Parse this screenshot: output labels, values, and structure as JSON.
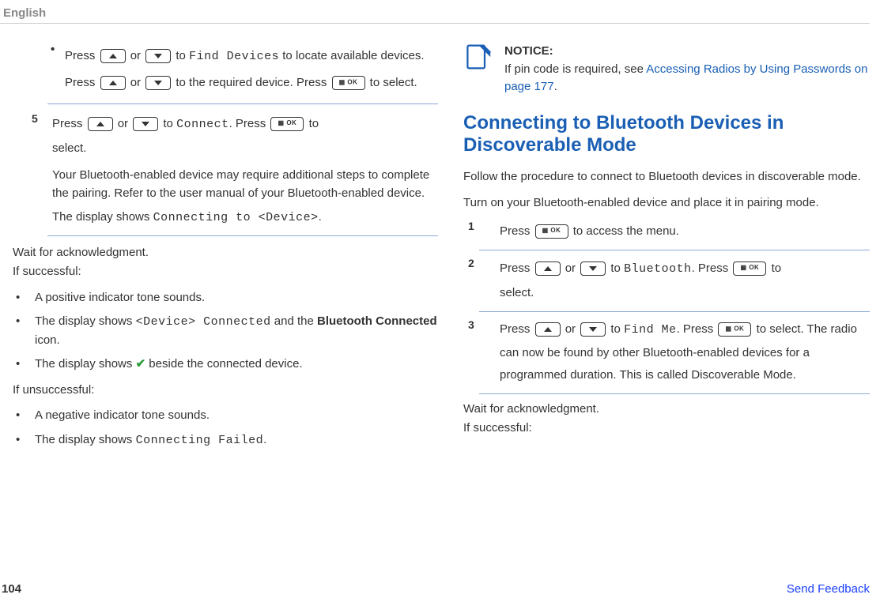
{
  "header": {
    "language": "English"
  },
  "left": {
    "step_prev_bullet": {
      "press": "Press",
      "or": "or",
      "to1": "to",
      "find_devices": "Find Devices",
      "to_locate": "to locate",
      "line2": "available devices. Press",
      "or2": "or",
      "to_the": "to the",
      "line3": "required device. Press",
      "to_select": "to select."
    },
    "step5": {
      "num": "5",
      "press": "Press",
      "or": "or",
      "to": "to",
      "connect": "Connect",
      "dot_press": ". Press",
      "to_select": "to",
      "select2": "select.",
      "para2": "Your Bluetooth-enabled device may require additional steps to complete the pairing. Refer to the user manual of your Bluetooth-enabled device.",
      "para3a": "The display shows ",
      "para3b": "Connecting to <Device>",
      "para3c": "."
    },
    "wait": "Wait for acknowledgment.",
    "if_success": "If successful:",
    "success_list": {
      "b1": "A positive indicator tone sounds.",
      "b2a": "The display shows ",
      "b2b": "<Device> Connected",
      "b2c": " and the ",
      "b2d": "Bluetooth Connected",
      "b2e": " icon.",
      "b3a": "The display shows ",
      "b3b": " beside the connected device."
    },
    "if_unsuccess": "If unsuccessful:",
    "fail_list": {
      "b1": "A negative indicator tone sounds.",
      "b2a": "The display shows ",
      "b2b": "Connecting Failed",
      "b2c": "."
    }
  },
  "right": {
    "notice": {
      "label": "NOTICE:",
      "text": "If pin code is required, see ",
      "link": "Accessing Radios by Using Passwords on page 177",
      "dot": "."
    },
    "heading": "Connecting to Bluetooth Devices in Discoverable Mode",
    "intro": "Follow the procedure to connect to Bluetooth devices in discoverable mode.",
    "turn_on": "Turn on your Bluetooth-enabled device and place it in pairing mode.",
    "s1": {
      "num": "1",
      "press": "Press",
      "to_access": "to access the menu."
    },
    "s2": {
      "num": "2",
      "press": "Press",
      "or": "or",
      "to": "to",
      "bluetooth": "Bluetooth",
      "dot_press": ". Press",
      "to_": "to",
      "select": "select."
    },
    "s3": {
      "num": "3",
      "press": "Press",
      "or": "or",
      "to": "to",
      "find_me": "Find Me",
      "dot_press": ". Press",
      "to_": "to",
      "tail": "select. The radio can now be found by other Bluetooth-enabled devices for a programmed duration. This is called Discoverable Mode."
    },
    "wait": "Wait for acknowledgment.",
    "if_success": "If successful:"
  },
  "footer": {
    "page": "104",
    "feedback": "Send Feedback"
  }
}
